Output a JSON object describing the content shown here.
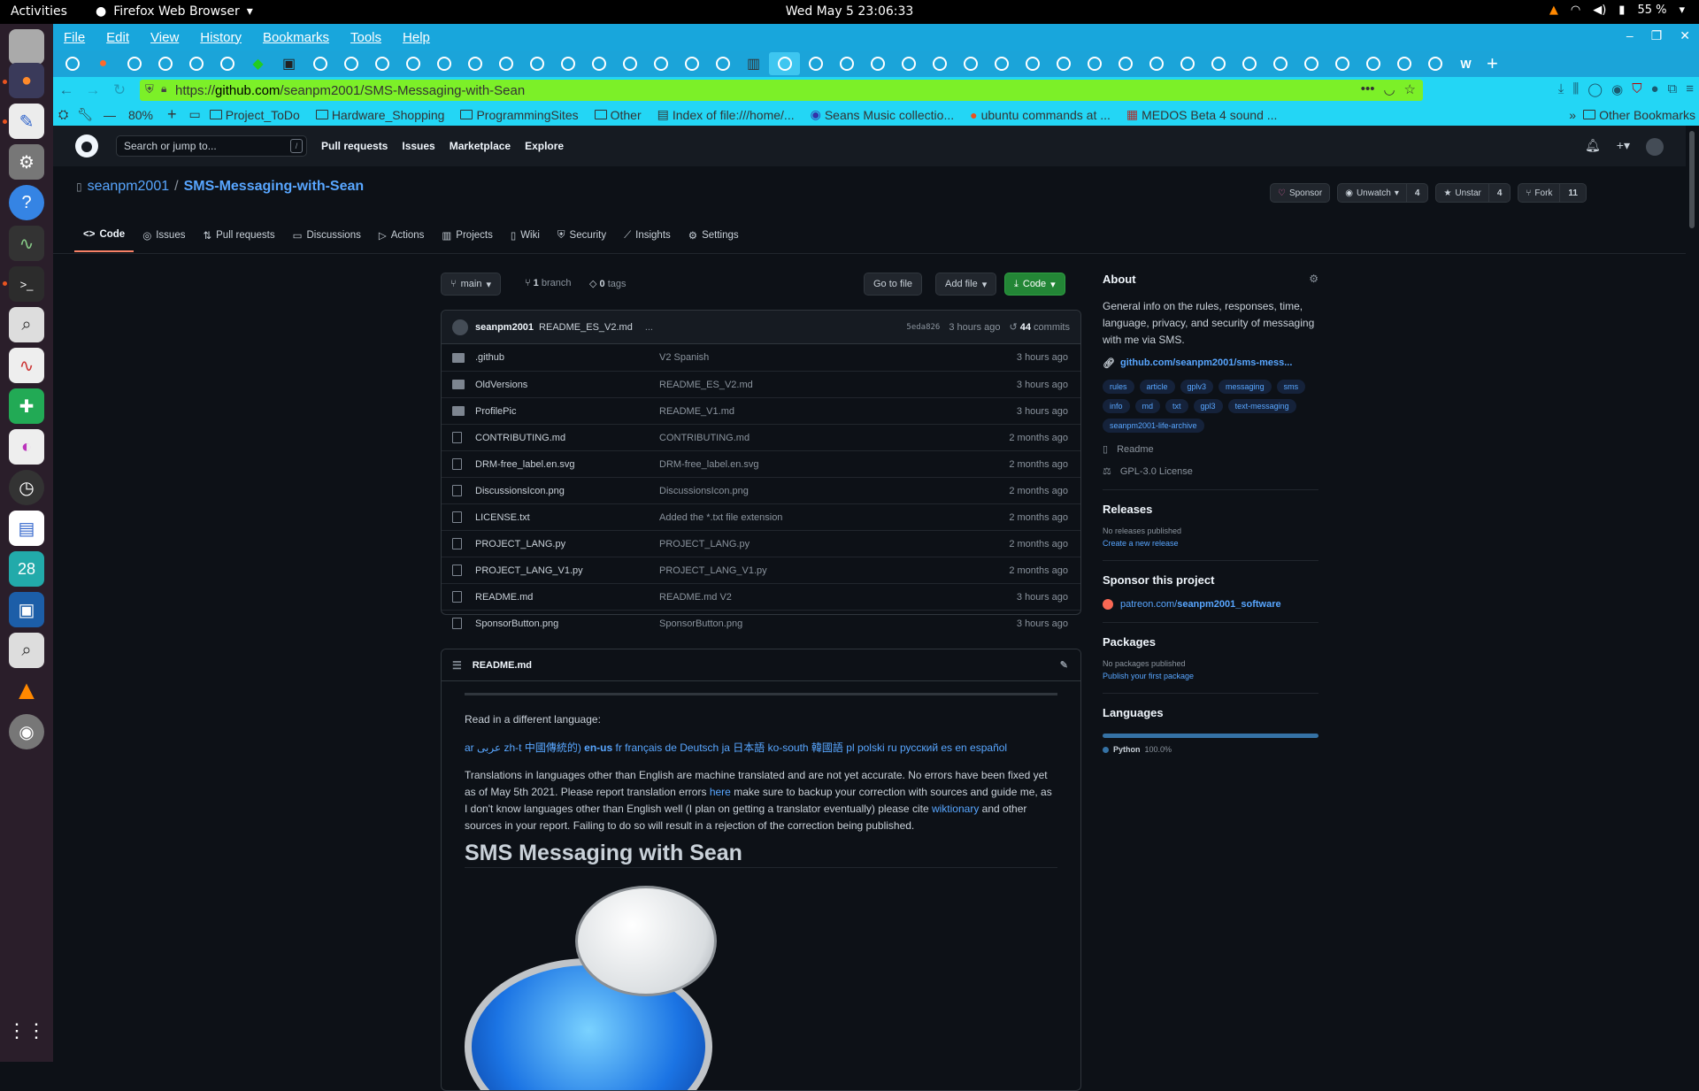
{
  "system": {
    "activities": "Activities",
    "app_name": "Firefox Web Browser",
    "clock": "Wed May 5  23:06:33",
    "battery": "55 %"
  },
  "browser": {
    "menu": [
      "File",
      "Edit",
      "View",
      "History",
      "Bookmarks",
      "Tools",
      "Help"
    ],
    "url_prefix": "https://",
    "url_domain": "github.com",
    "url_path": "/seanpm2001/SMS-Messaging-with-Sean",
    "zoom": "80%",
    "bookmarks": [
      "Project_ToDo",
      "Hardware_Shopping",
      "ProgrammingSites",
      "Other",
      "Index of file:///home/...",
      "Seans Music collectio...",
      "ubuntu commands at ...",
      "MEDOS Beta 4 sound ..."
    ],
    "other_bookmarks": "Other Bookmarks"
  },
  "github": {
    "search_placeholder": "Search or jump to...",
    "search_key": "/",
    "nav": [
      "Pull requests",
      "Issues",
      "Marketplace",
      "Explore"
    ],
    "owner": "seanpm2001",
    "separator": "/",
    "repo": "SMS-Messaging-with-Sean",
    "sponsor": "Sponsor",
    "unwatch": "Unwatch",
    "unwatch_count": "4",
    "unstar": "Unstar",
    "star_count": "4",
    "fork": "Fork",
    "fork_count": "11",
    "tabs": [
      "Code",
      "Issues",
      "Pull requests",
      "Discussions",
      "Actions",
      "Projects",
      "Wiki",
      "Security",
      "Insights",
      "Settings"
    ],
    "branch": "main",
    "branches_count": "1",
    "branches_label": "branch",
    "tags_count": "0",
    "tags_label": "tags",
    "go_to_file": "Go to file",
    "add_file": "Add file",
    "code_btn": "Code",
    "commit": {
      "user": "seanpm2001",
      "message": "README_ES_V2.md",
      "ellipsis": "...",
      "sha": "5eda826",
      "time": "3 hours ago",
      "count": "44",
      "count_label": "commits"
    },
    "files": [
      {
        "name": ".github",
        "msg": "V2 Spanish",
        "time": "3 hours ago",
        "type": "dir"
      },
      {
        "name": "OldVersions",
        "msg": "README_ES_V2.md",
        "time": "3 hours ago",
        "type": "dir"
      },
      {
        "name": "ProfilePic",
        "msg": "README_V1.md",
        "time": "3 hours ago",
        "type": "dir"
      },
      {
        "name": "CONTRIBUTING.md",
        "msg": "CONTRIBUTING.md",
        "time": "2 months ago",
        "type": "file"
      },
      {
        "name": "DRM-free_label.en.svg",
        "msg": "DRM-free_label.en.svg",
        "time": "2 months ago",
        "type": "file"
      },
      {
        "name": "DiscussionsIcon.png",
        "msg": "DiscussionsIcon.png",
        "time": "2 months ago",
        "type": "file"
      },
      {
        "name": "LICENSE.txt",
        "msg": "Added the *.txt file extension",
        "time": "2 months ago",
        "type": "file"
      },
      {
        "name": "PROJECT_LANG.py",
        "msg": "PROJECT_LANG.py",
        "time": "2 months ago",
        "type": "file"
      },
      {
        "name": "PROJECT_LANG_V1.py",
        "msg": "PROJECT_LANG_V1.py",
        "time": "2 months ago",
        "type": "file"
      },
      {
        "name": "README.md",
        "msg": "README.md V2",
        "time": "3 hours ago",
        "type": "file"
      },
      {
        "name": "SponsorButton.png",
        "msg": "SponsorButton.png",
        "time": "3 hours ago",
        "type": "file"
      }
    ],
    "readme": {
      "filename": "README.md",
      "lang_intro": "Read in a different language:",
      "lang_before": "ar عربى zh-t 中國傳統的)",
      "lang_current": "en-us",
      "lang_after": "fr français de Deutsch ja 日本語 ko-south 韓國語 pl polski ru русский es en español",
      "p1": "Translations in languages other than English are machine translated and are not yet accurate. No errors have been fixed yet as of May 5th 2021. Please report translation errors",
      "here": "here",
      "p2": "make sure to backup your correction with sources and guide me, as I don't know languages other than English well (I plan on getting a translator eventually) please cite",
      "wiktionary": "wiktionary",
      "p3": "and other sources in your report. Failing to do so will result in a rejection of the correction being published.",
      "heading": "SMS Messaging with Sean"
    },
    "about": {
      "title": "About",
      "description": "General info on the rules, responses, time, language, privacy, and security of messaging with me via SMS.",
      "link": "github.com/seanpm2001/sms-mess...",
      "topics": [
        "rules",
        "article",
        "gplv3",
        "messaging",
        "sms",
        "info",
        "md",
        "txt",
        "gpl3",
        "text-messaging",
        "seanpm2001-life-archive"
      ],
      "readme": "Readme",
      "license": "GPL-3.0 License"
    },
    "releases": {
      "title": "Releases",
      "none": "No releases published",
      "create": "Create a new release"
    },
    "sponsor_project": {
      "title": "Sponsor this project",
      "link_prefix": "patreon.com/",
      "link_bold": "seanpm2001_software"
    },
    "packages": {
      "title": "Packages",
      "none": "No packages published",
      "publish": "Publish your first package"
    },
    "languages": {
      "title": "Languages",
      "name": "Python",
      "percent": "100.0%",
      "share": 1.0
    }
  },
  "dock_badge": "28"
}
